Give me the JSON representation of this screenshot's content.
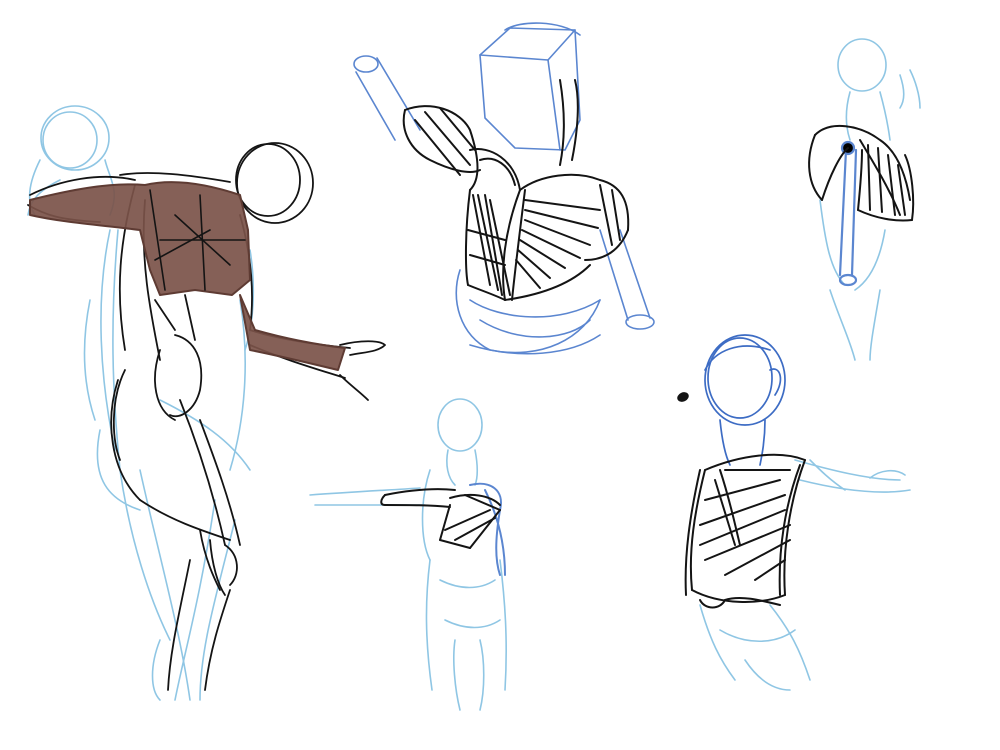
{
  "sheet": {
    "background": "#ffffff"
  },
  "colors": {
    "light_blue": "#8fc6e4",
    "mid_blue": "#5b86d0",
    "deep_blue": "#3d6cc4",
    "ink": "#141414",
    "brown_fill": "#7b5249",
    "brown_stroke": "#5e3b33"
  },
  "sketches": [
    {
      "name": "full-figure-chest-sketch",
      "icon": "human-figure"
    },
    {
      "name": "torso-shoulder-cutaway-sketch",
      "icon": "torso"
    },
    {
      "name": "shoulder-muscle-sketch",
      "icon": "shoulder"
    },
    {
      "name": "outstretched-arm-figure-sketch",
      "icon": "human-figure"
    },
    {
      "name": "torso-rib-cage-sketch",
      "icon": "torso"
    }
  ]
}
